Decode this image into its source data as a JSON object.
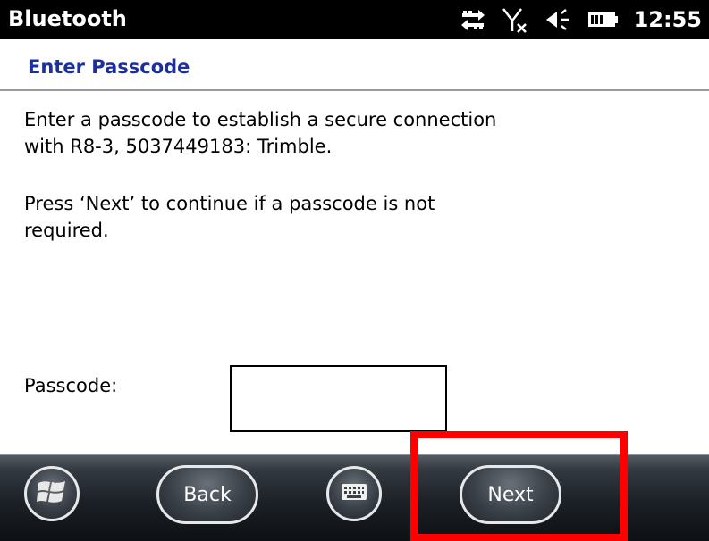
{
  "status_bar": {
    "title": "Bluetooth",
    "time": "12:55",
    "icons": [
      "data-transfer-icon",
      "no-signal-icon",
      "volume-icon",
      "battery-icon"
    ]
  },
  "page": {
    "heading": "Enter Passcode",
    "paragraph1": "Enter a passcode to establish a secure connection with R8-3, 5037449183: Trimble.",
    "paragraph2": "Press ‘Next’ to continue if a passcode is not required.",
    "passcode_label": "Passcode:",
    "passcode_value": ""
  },
  "softkeys": {
    "start_icon": "windows-start-icon",
    "back_label": "Back",
    "keyboard_icon": "keyboard-icon",
    "next_label": "Next"
  },
  "colors": {
    "heading": "#1c2fa0",
    "highlight": "#ff0000",
    "status_bar": "#000000"
  }
}
